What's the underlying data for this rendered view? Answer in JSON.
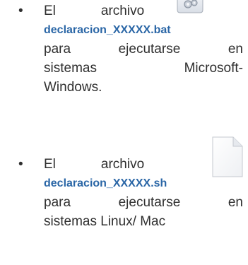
{
  "items": [
    {
      "bullet": "•",
      "line1": [
        "El",
        "archivo"
      ],
      "filename": "declaracion_XXXXX.bat",
      "line3": [
        "para",
        "ejecutarse",
        "en"
      ],
      "line4": [
        "sistemas",
        "Microsoft-"
      ],
      "line5": "Windows.",
      "icon": "batch-file-gear-icon"
    },
    {
      "bullet": "•",
      "line1": [
        "El",
        "archivo"
      ],
      "filename": "declaracion_XXXXX.sh",
      "line3": [
        "para",
        "ejecutarse",
        "en"
      ],
      "line4": "sistemas Linux/ Mac",
      "icon": "blank-document-icon"
    }
  ]
}
